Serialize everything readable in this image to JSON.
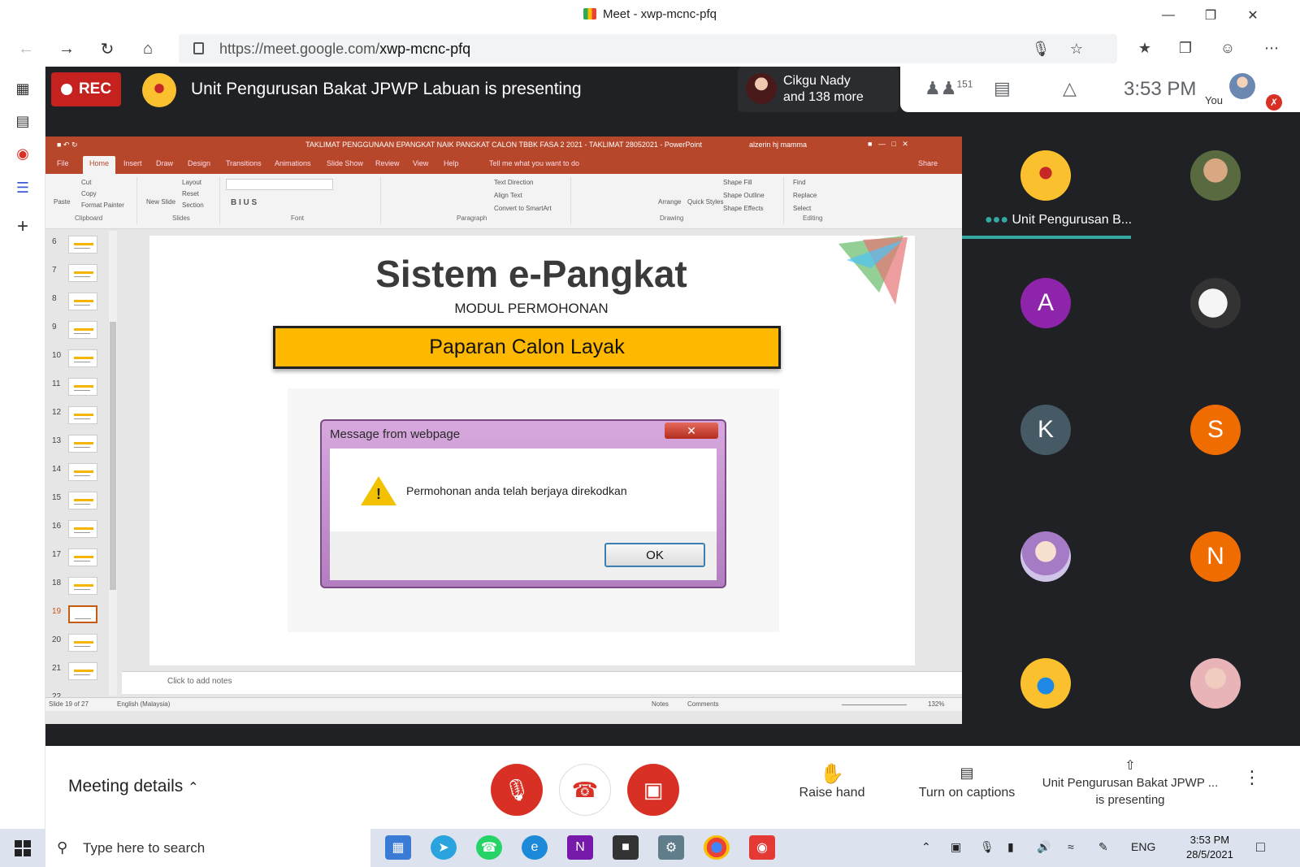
{
  "browser": {
    "title": "Meet - xwp-mcnc-pfq",
    "url_host": "https://meet.google.com/",
    "url_path": "xwp-mcnc-pfq"
  },
  "meet": {
    "rec_label": "REC",
    "presenting_title": "Unit Pengurusan Bakat JPWP Labuan is presenting",
    "viewer_name": "Cikgu Nady",
    "viewer_more": "and 138 more",
    "participant_count": "151",
    "time": "3:53 PM",
    "you_label": "You"
  },
  "ppt": {
    "window_title": "TAKLIMAT PENGGUNAAN EPANGKAT NAIK PANGKAT CALON TBBK FASA 2 2021 - TAKLIMAT 28052021 - PowerPoint",
    "user": "alzerin hj mamma",
    "tabs": [
      "File",
      "Home",
      "Insert",
      "Draw",
      "Design",
      "Transitions",
      "Animations",
      "Slide Show",
      "Review",
      "View",
      "Help"
    ],
    "tell_me": "Tell me what you want to do",
    "share": "Share",
    "groups": [
      "Clipboard",
      "Slides",
      "Font",
      "Paragraph",
      "Drawing",
      "Editing"
    ],
    "ribbon": {
      "paste": "Paste",
      "cut": "Cut",
      "copy": "Copy",
      "format_painter": "Format Painter",
      "new_slide": "New Slide",
      "layout": "Layout",
      "reset": "Reset",
      "section": "Section",
      "text_direction": "Text Direction",
      "align_text": "Align Text",
      "smartart": "Convert to SmartArt",
      "arrange": "Arrange",
      "quick_styles": "Quick Styles",
      "shape_fill": "Shape Fill",
      "shape_outline": "Shape Outline",
      "shape_effects": "Shape Effects",
      "find": "Find",
      "replace": "Replace",
      "select": "Select"
    },
    "thumbnails": [
      "6",
      "7",
      "8",
      "9",
      "10",
      "11",
      "12",
      "13",
      "14",
      "15",
      "16",
      "17",
      "18",
      "19",
      "20",
      "21",
      "22"
    ],
    "selected_slide": "19",
    "slide": {
      "heading": "Sistem e-Pangkat",
      "subheading": "MODUL PERMOHONAN",
      "banner": "Paparan Calon Layak"
    },
    "dialog": {
      "title": "Message from webpage",
      "message": "Permohonan anda telah berjaya direkodkan",
      "ok": "OK"
    },
    "notes_placeholder": "Click to add notes",
    "status": {
      "slide": "Slide 19 of 27",
      "language": "English (Malaysia)",
      "notes": "Notes",
      "comments": "Comments",
      "zoom": "132%"
    }
  },
  "participants": [
    {
      "name": "Unit Pengurusan B...",
      "initial": "",
      "color": "#fbc02d"
    },
    {
      "name": "",
      "initial": "",
      "color": "#c8a080"
    },
    {
      "name": "",
      "initial": "A",
      "color": "#8e24aa"
    },
    {
      "name": "",
      "initial": "",
      "color": "#f5f5f5"
    },
    {
      "name": "",
      "initial": "K",
      "color": "#455a64"
    },
    {
      "name": "",
      "initial": "S",
      "color": "#ef6c00"
    },
    {
      "name": "",
      "initial": "",
      "color": "#d1c4e9"
    },
    {
      "name": "",
      "initial": "N",
      "color": "#ef6c00"
    },
    {
      "name": "",
      "initial": "",
      "color": "#fbc02d"
    },
    {
      "name": "",
      "initial": "",
      "color": "#e8b4b8"
    }
  ],
  "bottom": {
    "meeting_details": "Meeting details",
    "raise_hand": "Raise hand",
    "captions": "Turn on captions",
    "presenting_line1": "Unit Pengurusan Bakat JPWP ...",
    "presenting_line2": "is presenting"
  },
  "taskbar": {
    "search_placeholder": "Type here to search",
    "lang": "ENG",
    "time": "3:53 PM",
    "date": "28/5/2021"
  },
  "colors": {
    "meet_bg": "#202124",
    "rec_red": "#c5221f",
    "ppt_orange": "#b7472a",
    "banner_yellow": "#ffb800",
    "end_call_red": "#d93025"
  }
}
